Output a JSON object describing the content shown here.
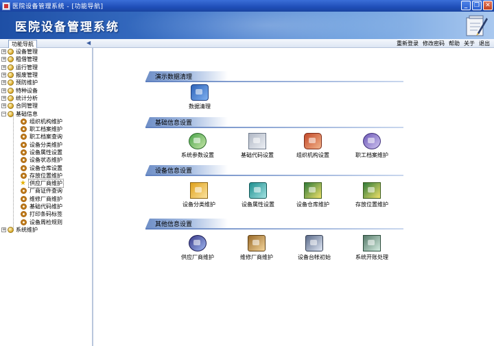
{
  "window": {
    "title": "医院设备管理系统 - [功能导航]",
    "minimize": "_",
    "restore": "❐",
    "close": "✕"
  },
  "banner": {
    "title": "医院设备管理系统"
  },
  "toolbar": {
    "nav_tab": "功能导航",
    "collapse": "◀",
    "links": [
      "重新登录",
      "修改密码",
      "帮助",
      "关于",
      "退出"
    ]
  },
  "sidebar": {
    "items": [
      {
        "label": "设备管理",
        "expander": "+"
      },
      {
        "label": "租借管理",
        "expander": "+"
      },
      {
        "label": "运行管理",
        "expander": "+"
      },
      {
        "label": "报废管理",
        "expander": "+"
      },
      {
        "label": "预防维护",
        "expander": "+"
      },
      {
        "label": "特种设备",
        "expander": "+"
      },
      {
        "label": "统计分析",
        "expander": "+"
      },
      {
        "label": "合同管理",
        "expander": "+"
      },
      {
        "label": "基础信息",
        "expander": "−"
      }
    ],
    "children": [
      "组织机构维护",
      "职工档案维护",
      "职工档案查询",
      "设备分类维护",
      "设备属性设置",
      "设备状态维护",
      "设备仓库设置",
      "存放位置维护",
      "供应厂商维护",
      "厂商证件查询",
      "维修厂商维护",
      "基础代码维护",
      "打印条码标签",
      "设备周检规则"
    ],
    "selected_child": "供应厂商维护",
    "last_item": {
      "label": "系统维护",
      "expander": "+"
    }
  },
  "main": {
    "sections": [
      {
        "title": "演示数据清理",
        "items": [
          {
            "label": "数据清理",
            "icon": "data-cleanup-icon"
          }
        ]
      },
      {
        "title": "基础信息设置",
        "items": [
          {
            "label": "系统参数设置",
            "icon": "system-params-icon"
          },
          {
            "label": "基础代码设置",
            "icon": "base-code-icon"
          },
          {
            "label": "组织机构设置",
            "icon": "org-structure-icon"
          },
          {
            "label": "职工档案维护",
            "icon": "staff-archive-icon"
          }
        ]
      },
      {
        "title": "设备信息设置",
        "items": [
          {
            "label": "设备分类维护",
            "icon": "equipment-category-icon"
          },
          {
            "label": "设备属性设置",
            "icon": "equipment-attribute-icon"
          },
          {
            "label": "设备仓库维护",
            "icon": "warehouse-icon"
          },
          {
            "label": "存放位置维护",
            "icon": "storage-location-icon"
          }
        ]
      },
      {
        "title": "其他信息设置",
        "items": [
          {
            "label": "供应厂商维护",
            "icon": "supplier-icon"
          },
          {
            "label": "维修厂商维护",
            "icon": "repair-vendor-icon"
          },
          {
            "label": "设备台帐初始",
            "icon": "ledger-init-icon"
          },
          {
            "label": "系统开账处理",
            "icon": "account-open-icon"
          }
        ]
      }
    ]
  }
}
